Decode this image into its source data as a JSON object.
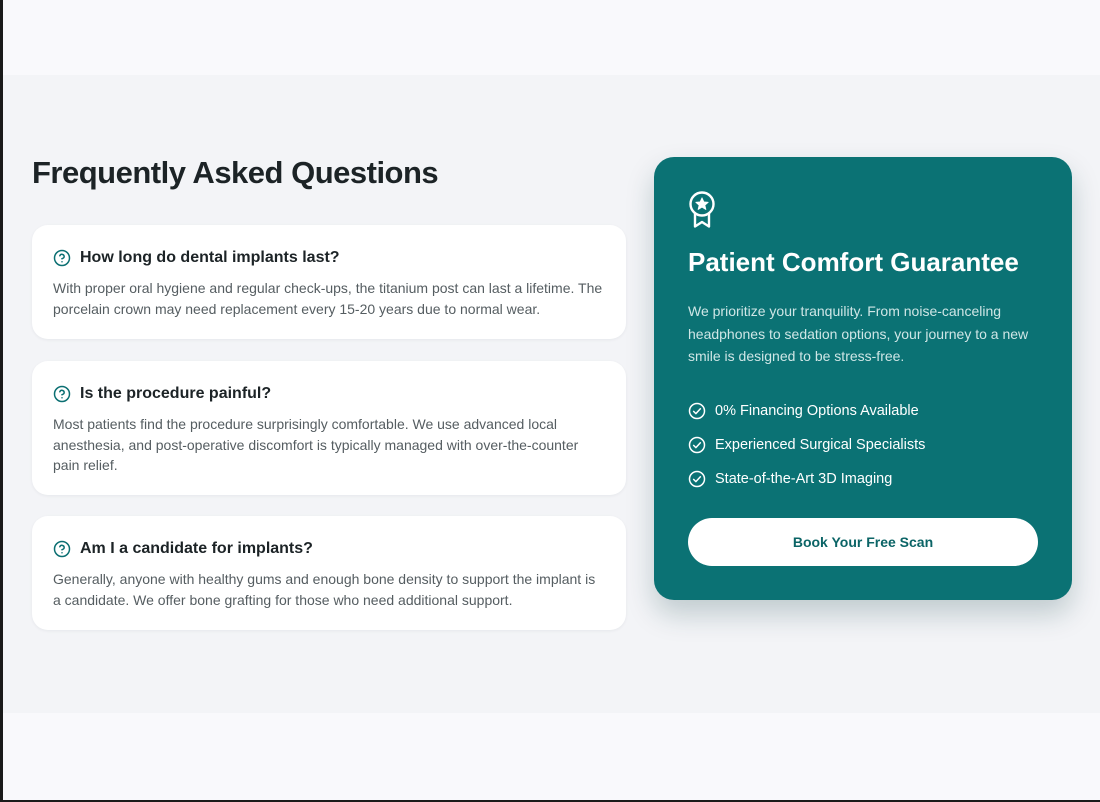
{
  "faq": {
    "title": "Frequently Asked Questions",
    "items": [
      {
        "question": "How long do dental implants last?",
        "answer": "With proper oral hygiene and regular check-ups, the titanium post can last a lifetime. The porcelain crown may need replacement every 15-20 years due to normal wear."
      },
      {
        "question": "Is the procedure painful?",
        "answer": "Most patients find the procedure surprisingly comfortable. We use advanced local anesthesia, and post-operative discomfort is typically managed with over-the-counter pain relief."
      },
      {
        "question": "Am I a candidate for implants?",
        "answer": "Generally, anyone with healthy gums and enough bone density to support the implant is a candidate. We offer bone grafting for those who need additional support."
      }
    ]
  },
  "guarantee": {
    "icon": "award-icon",
    "title": "Patient Comfort Guarantee",
    "text": "We prioritize your tranquility. From noise-canceling headphones to sedation options, your journey to a new smile is designed to be stress-free.",
    "features": [
      "0% Financing Options Available",
      "Experienced Surgical Specialists",
      "State-of-the-Art 3D Imaging"
    ],
    "button_label": "Book Your Free Scan"
  },
  "colors": {
    "accent": "#0b7274",
    "background": "#f3f4f7",
    "card": "#ffffff",
    "heading": "#1c2326"
  }
}
